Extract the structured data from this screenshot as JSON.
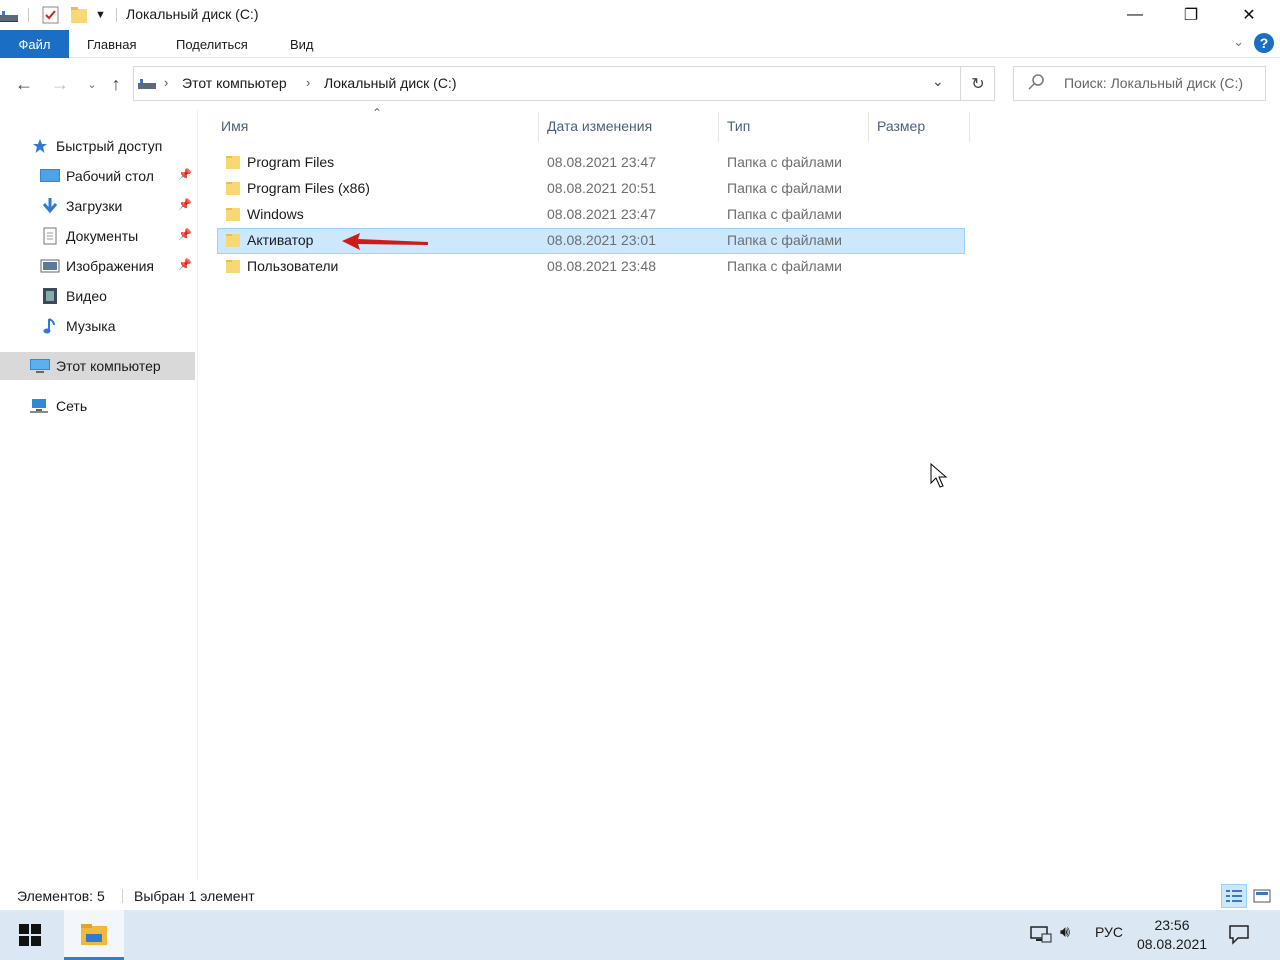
{
  "window": {
    "title": "Локальный диск (C:)",
    "minimize_glyph": "—",
    "restore_glyph": "❐",
    "close_glyph": "✕"
  },
  "ribbon": {
    "tabs": [
      "Файл",
      "Главная",
      "Поделиться",
      "Вид"
    ],
    "help_glyph": "?"
  },
  "address": {
    "crumbs": [
      "Этот компьютер",
      "Локальный диск (C:)"
    ],
    "search_placeholder": "Поиск: Локальный диск (C:)"
  },
  "nav": {
    "quick_access": "Быстрый доступ",
    "items": [
      {
        "label": "Рабочий стол",
        "pinned": true,
        "icon": "desktop-icon"
      },
      {
        "label": "Загрузки",
        "pinned": true,
        "icon": "downloads-icon"
      },
      {
        "label": "Документы",
        "pinned": true,
        "icon": "documents-icon"
      },
      {
        "label": "Изображения",
        "pinned": true,
        "icon": "pictures-icon"
      },
      {
        "label": "Видео",
        "pinned": false,
        "icon": "video-icon"
      },
      {
        "label": "Музыка",
        "pinned": false,
        "icon": "music-icon"
      }
    ],
    "this_pc": "Этот компьютер",
    "network": "Сеть"
  },
  "list": {
    "columns": [
      "Имя",
      "Дата изменения",
      "Тип",
      "Размер"
    ],
    "rows": [
      {
        "name": "Program Files",
        "date": "08.08.2021 23:47",
        "type": "Папка с файлами",
        "selected": false
      },
      {
        "name": "Program Files (x86)",
        "date": "08.08.2021 20:51",
        "type": "Папка с файлами",
        "selected": false
      },
      {
        "name": "Windows",
        "date": "08.08.2021 23:47",
        "type": "Папка с файлами",
        "selected": false
      },
      {
        "name": "Активатор",
        "date": "08.08.2021 23:01",
        "type": "Папка с файлами",
        "selected": true
      },
      {
        "name": "Пользователи",
        "date": "08.08.2021 23:48",
        "type": "Папка с файлами",
        "selected": false
      }
    ]
  },
  "status": {
    "count": "Элементов: 5",
    "selection": "Выбран 1 элемент"
  },
  "taskbar": {
    "lang": "РУС",
    "time": "23:56",
    "date": "08.08.2021"
  },
  "colors": {
    "accent": "#1a6fc4",
    "selection": "#cce8ff",
    "annotation_arrow": "#d01a1a",
    "folder": "#f8d775"
  }
}
